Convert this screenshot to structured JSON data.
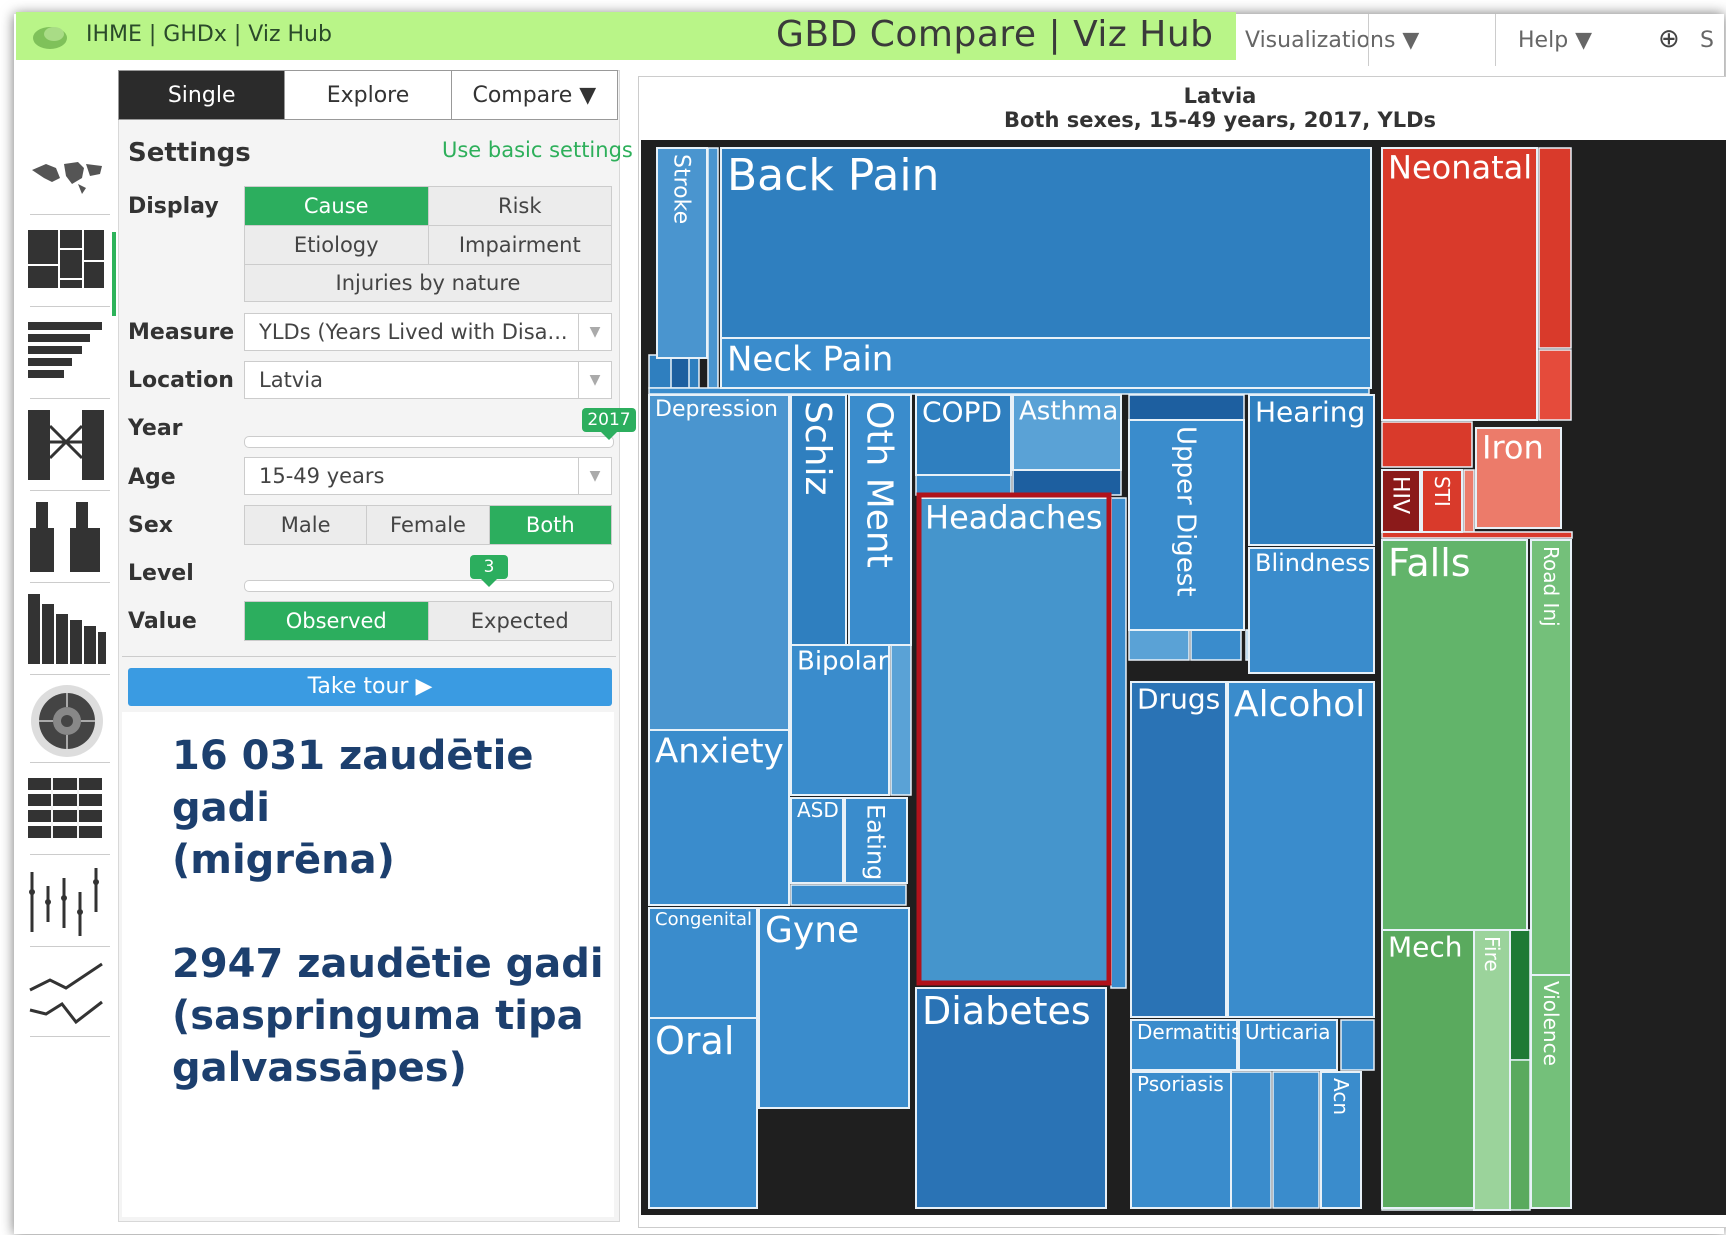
{
  "header": {
    "brand": "IHME | GHDx | Viz Hub",
    "app_title": "GBD Compare | Viz Hub",
    "menu_visualizations": "Visualizations ▼",
    "menu_help": "Help ▼",
    "globe_icon": "globe-icon",
    "colors": {
      "bar": "#b9f588"
    }
  },
  "tabs": [
    "Single",
    "Explore",
    "Compare ▼"
  ],
  "settings": {
    "title": "Settings",
    "basic_link": "Use basic settings",
    "display_label": "Display",
    "display_options": [
      "Cause",
      "Risk",
      "Etiology",
      "Impairment",
      "Injuries by nature"
    ],
    "display_selected": "Cause",
    "measure_label": "Measure",
    "measure_value": "YLDs (Years Lived with Disa...",
    "location_label": "Location",
    "location_value": "Latvia",
    "year_label": "Year",
    "year_value": "2017",
    "age_label": "Age",
    "age_value": "15-49 years",
    "sex_label": "Sex",
    "sex_options": [
      "Male",
      "Female",
      "Both"
    ],
    "sex_selected": "Both",
    "level_label": "Level",
    "level_value": "3",
    "value_label": "Value",
    "value_options": [
      "Observed",
      "Expected"
    ],
    "value_selected": "Observed",
    "tour_button": "Take tour ▶"
  },
  "overlay": {
    "line1": "16 031 zaudētie",
    "line2": "gadi",
    "line3": "(migrēna)",
    "line4": "2947 zaudētie gadi",
    "line5": "(saspringuma tipa",
    "line6": "galvassāpes)"
  },
  "chart": {
    "title": "Latvia",
    "subtitle": "Both sexes, 15-49 years, 2017, YLDs",
    "highlight_color": "#b0121b"
  },
  "chart_data": {
    "type": "treemap",
    "title": "Latvia",
    "subtitle": "Both sexes, 15-49 years, 2017, YLDs",
    "cells": [
      {
        "label": "Back Pain",
        "color": "#2f7fbf"
      },
      {
        "label": "Neck Pain",
        "color": "#3a8ccc"
      },
      {
        "label": "Stroke",
        "color": "#4a95cf"
      },
      {
        "label": "Depression",
        "color": "#4a95cf"
      },
      {
        "label": "Schiz",
        "color": "#2f7fbf"
      },
      {
        "label": "Oth Ment",
        "color": "#3a8ccc"
      },
      {
        "label": "Anxiety",
        "color": "#3a8ccc"
      },
      {
        "label": "Bipolar",
        "color": "#3a8ccc"
      },
      {
        "label": "ASD",
        "color": "#3a8ccc"
      },
      {
        "label": "Eating",
        "color": "#3a8ccc"
      },
      {
        "label": "COPD",
        "color": "#2f7fbf"
      },
      {
        "label": "Asthma",
        "color": "#5aa2d6"
      },
      {
        "label": "Headaches",
        "color": "#4595cc",
        "highlighted": true
      },
      {
        "label": "Upper Digest",
        "color": "#3a8ccc"
      },
      {
        "label": "Hearing",
        "color": "#2f7fbf"
      },
      {
        "label": "Blindness",
        "color": "#3a8ccc"
      },
      {
        "label": "Drugs",
        "color": "#2a73b5"
      },
      {
        "label": "Alcohol",
        "color": "#3a8ccc"
      },
      {
        "label": "Congenital",
        "color": "#3a8ccc"
      },
      {
        "label": "Gyne",
        "color": "#3a8ccc"
      },
      {
        "label": "Oral",
        "color": "#3a8ccc"
      },
      {
        "label": "Diabetes",
        "color": "#2a73b5"
      },
      {
        "label": "Dermatitis",
        "color": "#3a8ccc"
      },
      {
        "label": "Urticaria",
        "color": "#3a8ccc"
      },
      {
        "label": "Psoriasis",
        "color": "#3a8ccc"
      },
      {
        "label": "Acn",
        "color": "#3a8ccc"
      },
      {
        "label": "Neonatal",
        "color": "#d93a2b"
      },
      {
        "label": "Iron",
        "color": "#ec7b6a"
      },
      {
        "label": "HIV",
        "color": "#8b1a1a"
      },
      {
        "label": "STI",
        "color": "#d93a2b"
      },
      {
        "label": "Falls",
        "color": "#62b46a"
      },
      {
        "label": "Road Inj",
        "color": "#74c07a"
      },
      {
        "label": "Mech",
        "color": "#5aaa5e"
      },
      {
        "label": "Fire",
        "color": "#9bd39b"
      },
      {
        "label": "Violence",
        "color": "#74c07a"
      }
    ]
  }
}
